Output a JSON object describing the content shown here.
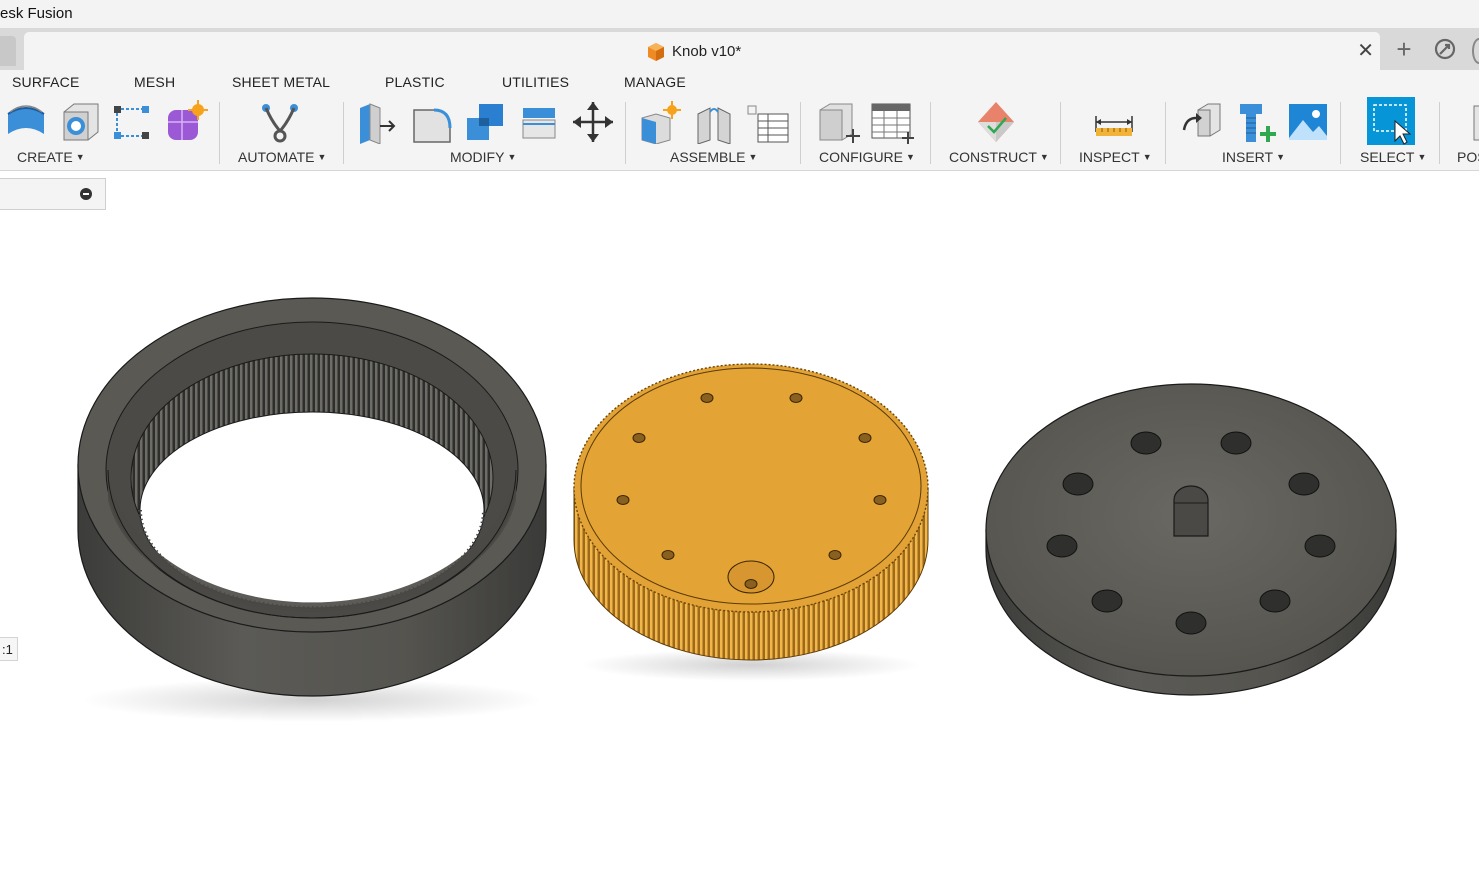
{
  "app": {
    "title": "esk Fusion"
  },
  "document": {
    "tab_title": "Knob v10*"
  },
  "menu_tabs": [
    "SURFACE",
    "MESH",
    "SHEET METAL",
    "PLASTIC",
    "UTILITIES",
    "MANAGE"
  ],
  "toolbar": {
    "groups": [
      {
        "label": "CREATE",
        "icons": [
          "extrude-surface-icon",
          "revolve-icon",
          "sketch-points-icon",
          "form-icon"
        ]
      },
      {
        "label": "AUTOMATE",
        "icons": [
          "automate-icon"
        ]
      },
      {
        "label": "MODIFY",
        "icons": [
          "press-pull-icon",
          "fillet-icon",
          "combine-icon",
          "offset-face-icon",
          "move-icon"
        ]
      },
      {
        "label": "ASSEMBLE",
        "icons": [
          "new-component-icon",
          "joint-icon",
          "bom-table-icon"
        ]
      },
      {
        "label": "CONFIGURE",
        "icons": [
          "configure-icon",
          "config-table-icon"
        ]
      },
      {
        "label": "CONSTRUCT",
        "icons": [
          "offset-plane-icon"
        ]
      },
      {
        "label": "INSPECT",
        "icons": [
          "measure-icon"
        ]
      },
      {
        "label": "INSERT",
        "icons": [
          "insert-derive-icon",
          "insert-mcmaster-icon",
          "insert-canvas-icon"
        ]
      },
      {
        "label": "SELECT",
        "icons": [
          "window-select-icon"
        ]
      },
      {
        "label": "POS",
        "icons": [
          "position-icon"
        ]
      }
    ]
  },
  "viewport": {
    "scale_label": ":1"
  },
  "colors": {
    "accent_blue": "#0696d7",
    "knob_gold": "#e2a235",
    "body_dark": "#4a4a48"
  }
}
